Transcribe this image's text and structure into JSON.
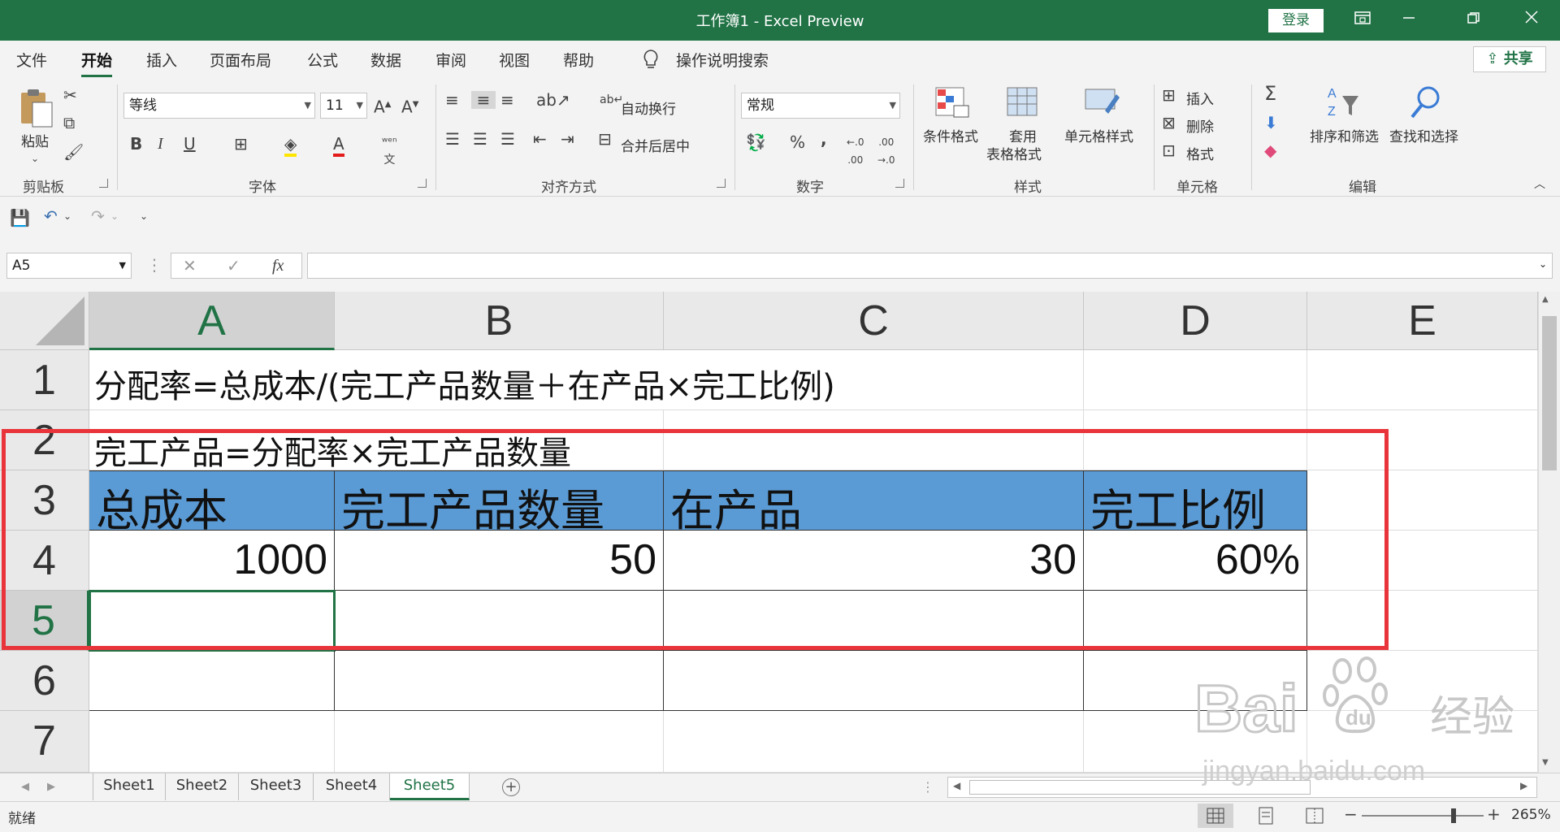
{
  "window": {
    "title": "工作簿1  -  Excel Preview",
    "login": "登录"
  },
  "menu": {
    "tabs": [
      "文件",
      "开始",
      "插入",
      "页面布局",
      "公式",
      "数据",
      "审阅",
      "视图",
      "帮助"
    ],
    "active_tab": "开始",
    "search": "操作说明搜索",
    "share": "共享"
  },
  "ribbon": {
    "clipboard": {
      "paste": "粘贴",
      "label": "剪贴板"
    },
    "font": {
      "name": "等线",
      "size": "11",
      "label": "字体",
      "bold": "B",
      "italic": "I",
      "underline": "U"
    },
    "alignment": {
      "wrap": "自动换行",
      "merge": "合并后居中",
      "label": "对齐方式"
    },
    "number": {
      "format": "常规",
      "percent": "%",
      "comma": ",",
      "label": "数字"
    },
    "styles": {
      "conditional": "条件格式",
      "table1": "套用",
      "table2": "表格格式",
      "cell_styles": "单元格样式",
      "label": "样式"
    },
    "cells": {
      "insert": "插入",
      "delete": "删除",
      "format": "格式",
      "label": "单元格"
    },
    "editing": {
      "sort": "排序和筛选",
      "find": "查找和选择",
      "label": "编辑"
    }
  },
  "formula_bar": {
    "name_box": "A5",
    "fx": "fx",
    "content": ""
  },
  "grid": {
    "columns": [
      "A",
      "B",
      "C",
      "D",
      "E"
    ],
    "selected_column": "A",
    "rows": [
      "1",
      "2",
      "3",
      "4",
      "5",
      "6",
      "7"
    ],
    "selected_row": "5",
    "row1_text": "分配率=总成本/(完工产品数量＋在产品×完工比例)",
    "row2_text": "完工产品=分配率×完工产品数量",
    "headers": [
      "总成本",
      "完工产品数量",
      "在产品",
      "完工比例"
    ],
    "values": [
      "1000",
      "50",
      "30",
      "60%"
    ],
    "header_fill": "#5b9bd5",
    "annotation_color": "#e8343a"
  },
  "sheets": {
    "tabs": [
      "Sheet1",
      "Sheet2",
      "Sheet3",
      "Sheet4",
      "Sheet5"
    ],
    "active": "Sheet5"
  },
  "status": {
    "mode": "就绪",
    "zoom": "265%"
  },
  "watermark": {
    "brand": "Baidu",
    "suffix": "经验",
    "url": "jingyan.baidu.com"
  }
}
